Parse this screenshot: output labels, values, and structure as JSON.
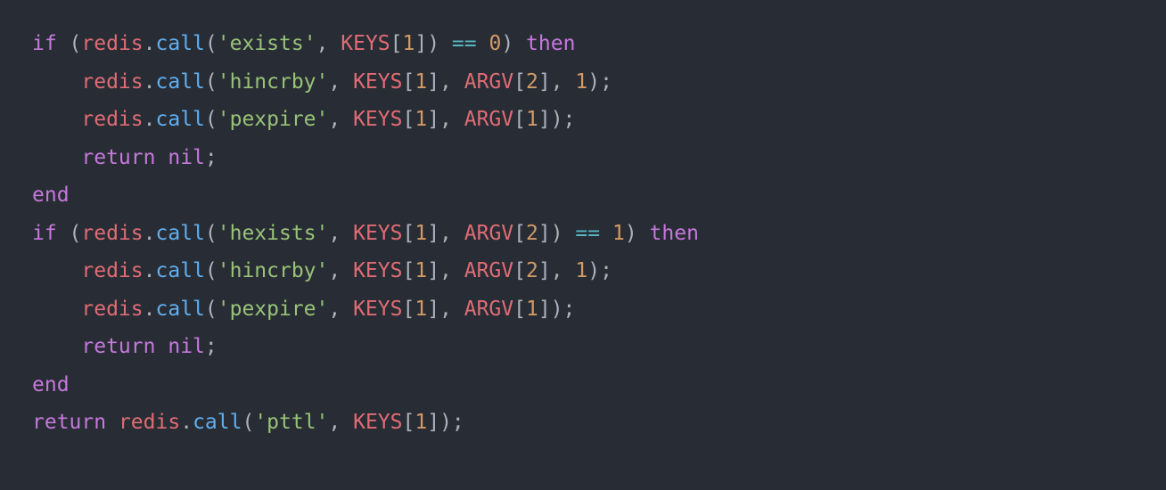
{
  "code": {
    "language": "lua",
    "tokens": [
      [
        {
          "t": "kw",
          "v": "if"
        },
        {
          "t": "punc",
          "v": " ("
        },
        {
          "t": "id",
          "v": "redis"
        },
        {
          "t": "punc",
          "v": "."
        },
        {
          "t": "fn",
          "v": "call"
        },
        {
          "t": "punc",
          "v": "("
        },
        {
          "t": "str",
          "v": "'exists'"
        },
        {
          "t": "punc",
          "v": ", "
        },
        {
          "t": "id",
          "v": "KEYS"
        },
        {
          "t": "punc",
          "v": "["
        },
        {
          "t": "num",
          "v": "1"
        },
        {
          "t": "punc",
          "v": "]) "
        },
        {
          "t": "op",
          "v": "=="
        },
        {
          "t": "punc",
          "v": " "
        },
        {
          "t": "num",
          "v": "0"
        },
        {
          "t": "punc",
          "v": ") "
        },
        {
          "t": "kw",
          "v": "then"
        }
      ],
      [
        {
          "t": "punc",
          "v": "    "
        },
        {
          "t": "id",
          "v": "redis"
        },
        {
          "t": "punc",
          "v": "."
        },
        {
          "t": "fn",
          "v": "call"
        },
        {
          "t": "punc",
          "v": "("
        },
        {
          "t": "str",
          "v": "'hincrby'"
        },
        {
          "t": "punc",
          "v": ", "
        },
        {
          "t": "id",
          "v": "KEYS"
        },
        {
          "t": "punc",
          "v": "["
        },
        {
          "t": "num",
          "v": "1"
        },
        {
          "t": "punc",
          "v": "], "
        },
        {
          "t": "id",
          "v": "ARGV"
        },
        {
          "t": "punc",
          "v": "["
        },
        {
          "t": "num",
          "v": "2"
        },
        {
          "t": "punc",
          "v": "], "
        },
        {
          "t": "num",
          "v": "1"
        },
        {
          "t": "punc",
          "v": ");"
        }
      ],
      [
        {
          "t": "punc",
          "v": "    "
        },
        {
          "t": "id",
          "v": "redis"
        },
        {
          "t": "punc",
          "v": "."
        },
        {
          "t": "fn",
          "v": "call"
        },
        {
          "t": "punc",
          "v": "("
        },
        {
          "t": "str",
          "v": "'pexpire'"
        },
        {
          "t": "punc",
          "v": ", "
        },
        {
          "t": "id",
          "v": "KEYS"
        },
        {
          "t": "punc",
          "v": "["
        },
        {
          "t": "num",
          "v": "1"
        },
        {
          "t": "punc",
          "v": "], "
        },
        {
          "t": "id",
          "v": "ARGV"
        },
        {
          "t": "punc",
          "v": "["
        },
        {
          "t": "num",
          "v": "1"
        },
        {
          "t": "punc",
          "v": "]);"
        }
      ],
      [
        {
          "t": "punc",
          "v": "    "
        },
        {
          "t": "kw",
          "v": "return"
        },
        {
          "t": "punc",
          "v": " "
        },
        {
          "t": "kw",
          "v": "nil"
        },
        {
          "t": "punc",
          "v": ";"
        }
      ],
      [
        {
          "t": "kw",
          "v": "end"
        }
      ],
      [
        {
          "t": "kw",
          "v": "if"
        },
        {
          "t": "punc",
          "v": " ("
        },
        {
          "t": "id",
          "v": "redis"
        },
        {
          "t": "punc",
          "v": "."
        },
        {
          "t": "fn",
          "v": "call"
        },
        {
          "t": "punc",
          "v": "("
        },
        {
          "t": "str",
          "v": "'hexists'"
        },
        {
          "t": "punc",
          "v": ", "
        },
        {
          "t": "id",
          "v": "KEYS"
        },
        {
          "t": "punc",
          "v": "["
        },
        {
          "t": "num",
          "v": "1"
        },
        {
          "t": "punc",
          "v": "], "
        },
        {
          "t": "id",
          "v": "ARGV"
        },
        {
          "t": "punc",
          "v": "["
        },
        {
          "t": "num",
          "v": "2"
        },
        {
          "t": "punc",
          "v": "]) "
        },
        {
          "t": "op",
          "v": "=="
        },
        {
          "t": "punc",
          "v": " "
        },
        {
          "t": "num",
          "v": "1"
        },
        {
          "t": "punc",
          "v": ") "
        },
        {
          "t": "kw",
          "v": "then"
        }
      ],
      [
        {
          "t": "punc",
          "v": "    "
        },
        {
          "t": "id",
          "v": "redis"
        },
        {
          "t": "punc",
          "v": "."
        },
        {
          "t": "fn",
          "v": "call"
        },
        {
          "t": "punc",
          "v": "("
        },
        {
          "t": "str",
          "v": "'hincrby'"
        },
        {
          "t": "punc",
          "v": ", "
        },
        {
          "t": "id",
          "v": "KEYS"
        },
        {
          "t": "punc",
          "v": "["
        },
        {
          "t": "num",
          "v": "1"
        },
        {
          "t": "punc",
          "v": "], "
        },
        {
          "t": "id",
          "v": "ARGV"
        },
        {
          "t": "punc",
          "v": "["
        },
        {
          "t": "num",
          "v": "2"
        },
        {
          "t": "punc",
          "v": "], "
        },
        {
          "t": "num",
          "v": "1"
        },
        {
          "t": "punc",
          "v": ");"
        }
      ],
      [
        {
          "t": "punc",
          "v": "    "
        },
        {
          "t": "id",
          "v": "redis"
        },
        {
          "t": "punc",
          "v": "."
        },
        {
          "t": "fn",
          "v": "call"
        },
        {
          "t": "punc",
          "v": "("
        },
        {
          "t": "str",
          "v": "'pexpire'"
        },
        {
          "t": "punc",
          "v": ", "
        },
        {
          "t": "id",
          "v": "KEYS"
        },
        {
          "t": "punc",
          "v": "["
        },
        {
          "t": "num",
          "v": "1"
        },
        {
          "t": "punc",
          "v": "], "
        },
        {
          "t": "id",
          "v": "ARGV"
        },
        {
          "t": "punc",
          "v": "["
        },
        {
          "t": "num",
          "v": "1"
        },
        {
          "t": "punc",
          "v": "]);"
        }
      ],
      [
        {
          "t": "punc",
          "v": "    "
        },
        {
          "t": "kw",
          "v": "return"
        },
        {
          "t": "punc",
          "v": " "
        },
        {
          "t": "kw",
          "v": "nil"
        },
        {
          "t": "punc",
          "v": ";"
        }
      ],
      [
        {
          "t": "kw",
          "v": "end"
        }
      ],
      [
        {
          "t": "kw",
          "v": "return"
        },
        {
          "t": "punc",
          "v": " "
        },
        {
          "t": "id",
          "v": "redis"
        },
        {
          "t": "punc",
          "v": "."
        },
        {
          "t": "fn",
          "v": "call"
        },
        {
          "t": "punc",
          "v": "("
        },
        {
          "t": "str",
          "v": "'pttl'"
        },
        {
          "t": "punc",
          "v": ", "
        },
        {
          "t": "id",
          "v": "KEYS"
        },
        {
          "t": "punc",
          "v": "["
        },
        {
          "t": "num",
          "v": "1"
        },
        {
          "t": "punc",
          "v": "]);"
        }
      ]
    ]
  }
}
